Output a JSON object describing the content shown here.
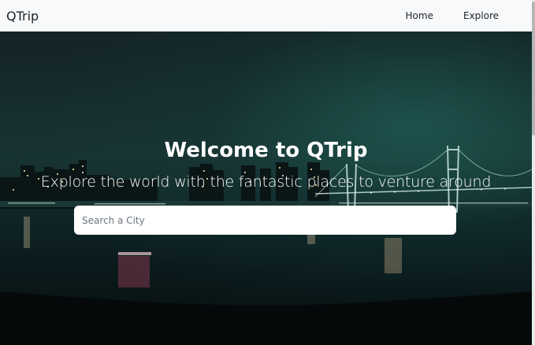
{
  "navbar": {
    "brand": "QTrip",
    "links": [
      {
        "label": "Home"
      },
      {
        "label": "Explore"
      }
    ]
  },
  "hero": {
    "title": "Welcome to QTrip",
    "subtitle": "Explore the world with the fantastic places to venture around",
    "search": {
      "placeholder": "Search a City",
      "value": ""
    }
  }
}
